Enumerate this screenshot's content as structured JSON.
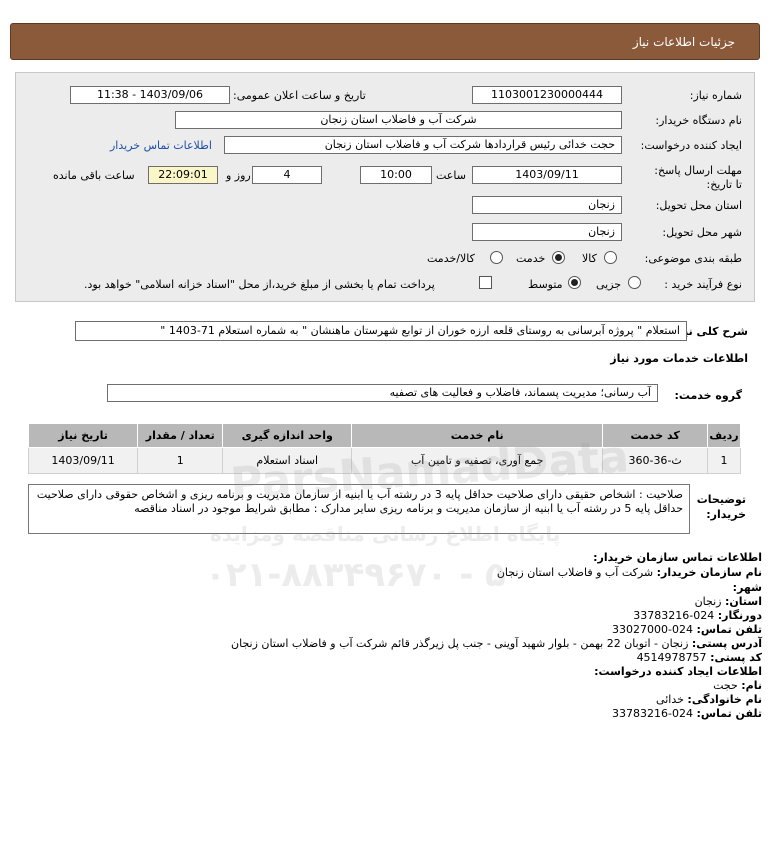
{
  "header": {
    "title": "جزئیات اطلاعات نیاز"
  },
  "form": {
    "need_number_label": "شماره نیاز:",
    "need_number": "1103001230000444",
    "announce_label": "تاریخ و ساعت اعلان عمومی:",
    "announce_value": "1403/09/06 - 11:38",
    "buyer_org_label": "نام دستگاه خریدار:",
    "buyer_org": "شرکت آب و فاضلاب استان زنجان",
    "creator_label": "ایجاد کننده درخواست:",
    "creator": "حجت  خدائی رئیس قراردادها شرکت آب و فاضلاب استان زنجان",
    "contact_link": "اطلاعات تماس خریدار",
    "deadline_label": "مهلت ارسال پاسخ: تا تاریخ:",
    "deadline_date": "1403/09/11",
    "time_label": "ساعت",
    "deadline_time": "10:00",
    "days_value": "4",
    "days_label": "روز و",
    "remaining_time": "22:09:01",
    "remaining_label": "ساعت باقی مانده",
    "province_label": "استان محل تحویل:",
    "province": "زنجان",
    "city_label": "شهر محل تحویل:",
    "city": "زنجان",
    "category_label": "طبقه بندی موضوعی:",
    "category_options": [
      "کالا",
      "خدمت",
      "کالا/خدمت"
    ],
    "category_selected": "خدمت",
    "process_label": "نوع فرآیند خرید :",
    "process_options": [
      "جزیی",
      "متوسط"
    ],
    "process_selected": "متوسط",
    "payment_note": "پرداخت تمام یا بخشی از مبلغ خرید،از محل \"اسناد خزانه اسلامی\" خواهد بود."
  },
  "summary": {
    "label": "شرح کلی نیاز:",
    "text": "استعلام \" پروژه آبرسانی به روستای قلعه ارزه خوران از توابع شهرستان ماهنشان \" به شماره استعلام 71-1403 \""
  },
  "services": {
    "section_title": "اطلاعات خدمات مورد نیاز",
    "group_label": "گروه خدمت:",
    "group_value": "آب رسانی؛ مدیریت پسماند، فاضلاب و فعالیت های تصفیه",
    "columns": [
      "ردیف",
      "کد خدمت",
      "نام خدمت",
      "واحد اندازه گیری",
      "تعداد / مقدار",
      "تاریخ نیاز"
    ],
    "rows": [
      {
        "row": "1",
        "code": "ث-36-360",
        "name": "جمع آوری، تصفیه و تامین آب",
        "unit": "اسناد استعلام",
        "qty": "1",
        "date": "1403/09/11"
      }
    ]
  },
  "notes": {
    "label": "توضیحات خریدار:",
    "text": "صلاحیت : اشخاص حقیقی دارای صلاحیت حداقل پایه 3 در رشته آب یا ابنیه از سازمان مدیریت و برنامه ریزی و اشخاص حقوقی دارای صلاحیت حداقل پایه 5 در رشته آب یا ابنیه از سازمان مدیریت و برنامه ریزی سایر مدارک : مطابق شرایط موجود در اسناد مناقصه"
  },
  "contact": {
    "title": "اطلاعات تماس سازمان خریدار:",
    "org_label": "نام سازمان خریدار:",
    "org": "شرکت آب و فاضلاب استان زنجان",
    "city_label": "شهر:",
    "city": "زنجان",
    "province_label": "استان:",
    "province": "زنجان",
    "fax_label": "دورنگار:",
    "fax": "024-33783216",
    "phone_label": "تلفن تماس:",
    "phone": "024-33027000",
    "address_label": "آدرس پستی:",
    "address": "زنجان - اتوبان 22 بهمن - بلوار شهید آوینی - جنب پل زیرگذر قائم شرکت آب و فاضلاب استان زنجان",
    "postal_label": "کد پستی:",
    "postal": "4514978757",
    "creator_title": "اطلاعات ایجاد کننده درخواست:",
    "name_label": "نام:",
    "name": "حجت",
    "family_label": "نام خانوادگی:",
    "family": "خدائی",
    "creator_phone_label": "تلفن تماس:",
    "creator_phone": "024-33783216"
  },
  "watermark": {
    "brand": "ParsNamadData",
    "line": "پایگاه اطلاع رسانی مناقصه ومزایده",
    "phone": "۰۲۱-۸۸۳۴۹۶۷۰ - ۵"
  }
}
